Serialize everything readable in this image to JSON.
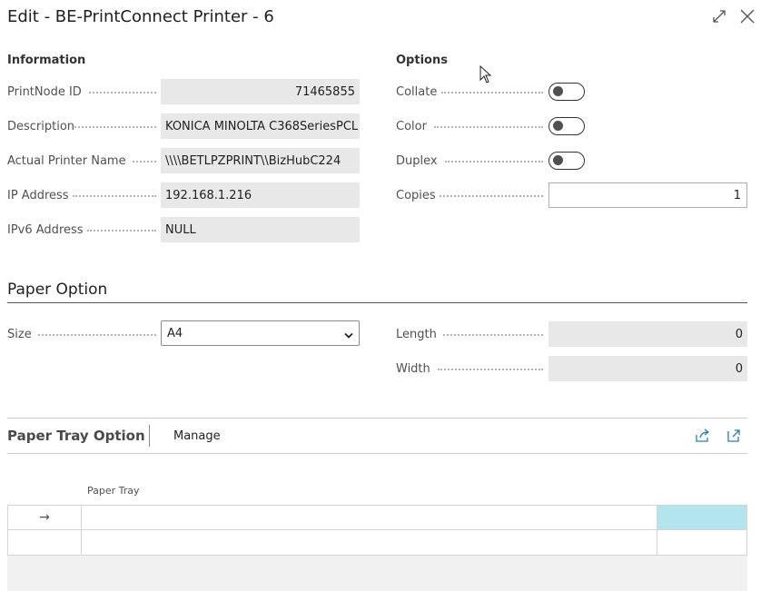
{
  "window": {
    "title": "Edit - BE-PrintConnect Printer - 6",
    "expand_icon": "expand-arrows-icon",
    "close_icon": "close-icon"
  },
  "information": {
    "heading": "Information",
    "fields": [
      {
        "label": "PrintNode ID",
        "value": "71465855"
      },
      {
        "label": "Description",
        "value": "KONICA MINOLTA C368SeriesPCL"
      },
      {
        "label": "Actual Printer Name",
        "value": "\\\\\\\\BETLPZPRINT\\\\BizHubC224"
      },
      {
        "label": "IP Address",
        "value": "192.168.1.216"
      },
      {
        "label": "IPv6 Address",
        "value": "NULL"
      }
    ]
  },
  "options": {
    "heading": "Options",
    "collate": {
      "label": "Collate",
      "on": false
    },
    "color": {
      "label": "Color",
      "on": false
    },
    "duplex": {
      "label": "Duplex",
      "on": false
    },
    "copies": {
      "label": "Copies",
      "value": "1"
    }
  },
  "paper_option": {
    "heading": "Paper Option",
    "size": {
      "label": "Size",
      "value": "A4"
    },
    "length": {
      "label": "Length",
      "value": "0"
    },
    "width": {
      "label": "Width",
      "value": "0"
    }
  },
  "paper_tray": {
    "title": "Paper Tray Option",
    "manage_label": "Manage",
    "share_icon": "share-icon",
    "open_icon": "open-in-new-icon",
    "column_header": "Paper Tray",
    "row_arrow": "→",
    "accent_color": "#b3e6ec"
  }
}
